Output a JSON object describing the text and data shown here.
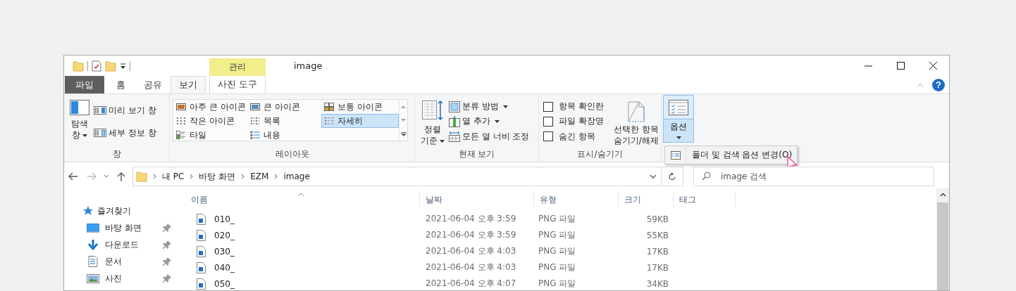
{
  "window": {
    "title": "image",
    "context_tab": "관리",
    "help": "?"
  },
  "tabs": [
    {
      "label": "파일",
      "kind": "file",
      "selected": false
    },
    {
      "label": "홈",
      "kind": "plain",
      "selected": false
    },
    {
      "label": "공유",
      "kind": "plain",
      "selected": false
    },
    {
      "label": "보기",
      "kind": "plain",
      "selected": true
    },
    {
      "label": "사진 도구",
      "kind": "context",
      "selected": false
    }
  ],
  "ribbon": {
    "panes": {
      "label": "창",
      "large": {
        "lines": [
          "탐색",
          "창"
        ],
        "dropdown": true
      },
      "items": [
        {
          "label": "미리 보기 창"
        },
        {
          "label": "세부 정보 창"
        }
      ]
    },
    "layout": {
      "label": "레이아웃",
      "items": [
        {
          "label": "아주 큰 아이콘",
          "selected": false
        },
        {
          "label": "큰 아이콘",
          "selected": false
        },
        {
          "label": "보통 아이콘",
          "selected": false
        },
        {
          "label": "작은 아이콘",
          "selected": false
        },
        {
          "label": "목록",
          "selected": false
        },
        {
          "label": "자세히",
          "selected": true
        },
        {
          "label": "타일",
          "selected": false
        },
        {
          "label": "내용",
          "selected": false
        }
      ]
    },
    "current_view": {
      "label": "현재 보기",
      "large": {
        "lines": [
          "정렬",
          "기준"
        ],
        "dropdown": true
      },
      "items": [
        {
          "label": "분류 방법",
          "dropdown": true
        },
        {
          "label": "열 추가",
          "dropdown": true
        },
        {
          "label": "모든 열 너비 조정",
          "dropdown": false
        }
      ]
    },
    "show_hide": {
      "label": "표시/숨기기",
      "checkboxes": [
        {
          "label": "항목 확인란",
          "checked": false
        },
        {
          "label": "파일 확장명",
          "checked": false
        },
        {
          "label": "숨긴 항목",
          "checked": false
        }
      ],
      "large": {
        "lines": [
          "선택한 항목",
          "숨기기/해제"
        ],
        "dropdown": false
      }
    },
    "options": {
      "lines": [
        "옵션"
      ],
      "dropdown": true,
      "pressed": true
    }
  },
  "options_menu": {
    "items": [
      "폴더 및 검색 옵션 변경(O)"
    ]
  },
  "address": {
    "path": [
      "내 PC",
      "바탕 화면",
      "EZM",
      "image"
    ]
  },
  "search": {
    "placeholder": "image 검색"
  },
  "navigation": {
    "header": "즐겨찾기",
    "items": [
      {
        "label": "바탕 화면",
        "pinned": true
      },
      {
        "label": "다운로드",
        "pinned": true
      },
      {
        "label": "문서",
        "pinned": true
      },
      {
        "label": "사진",
        "pinned": true
      }
    ]
  },
  "file_list": {
    "columns": [
      {
        "label": "이름",
        "sorted": true
      },
      {
        "label": "날짜",
        "sorted": false
      },
      {
        "label": "유형",
        "sorted": false
      },
      {
        "label": "크기",
        "sorted": false
      },
      {
        "label": "태그",
        "sorted": false
      }
    ],
    "rows": [
      {
        "name": "010_",
        "date": "2021-06-04 오후 3:59",
        "type": "PNG 파일",
        "size": "59KB"
      },
      {
        "name": "020_",
        "date": "2021-06-04 오후 3:59",
        "type": "PNG 파일",
        "size": "55KB"
      },
      {
        "name": "030_",
        "date": "2021-06-04 오후 4:03",
        "type": "PNG 파일",
        "size": "17KB"
      },
      {
        "name": "040_",
        "date": "2021-06-04 오후 4:03",
        "type": "PNG 파일",
        "size": "17KB"
      },
      {
        "name": "050_",
        "date": "2021-06-04 오후 4:07",
        "type": "PNG 파일",
        "size": "34KB"
      }
    ]
  }
}
